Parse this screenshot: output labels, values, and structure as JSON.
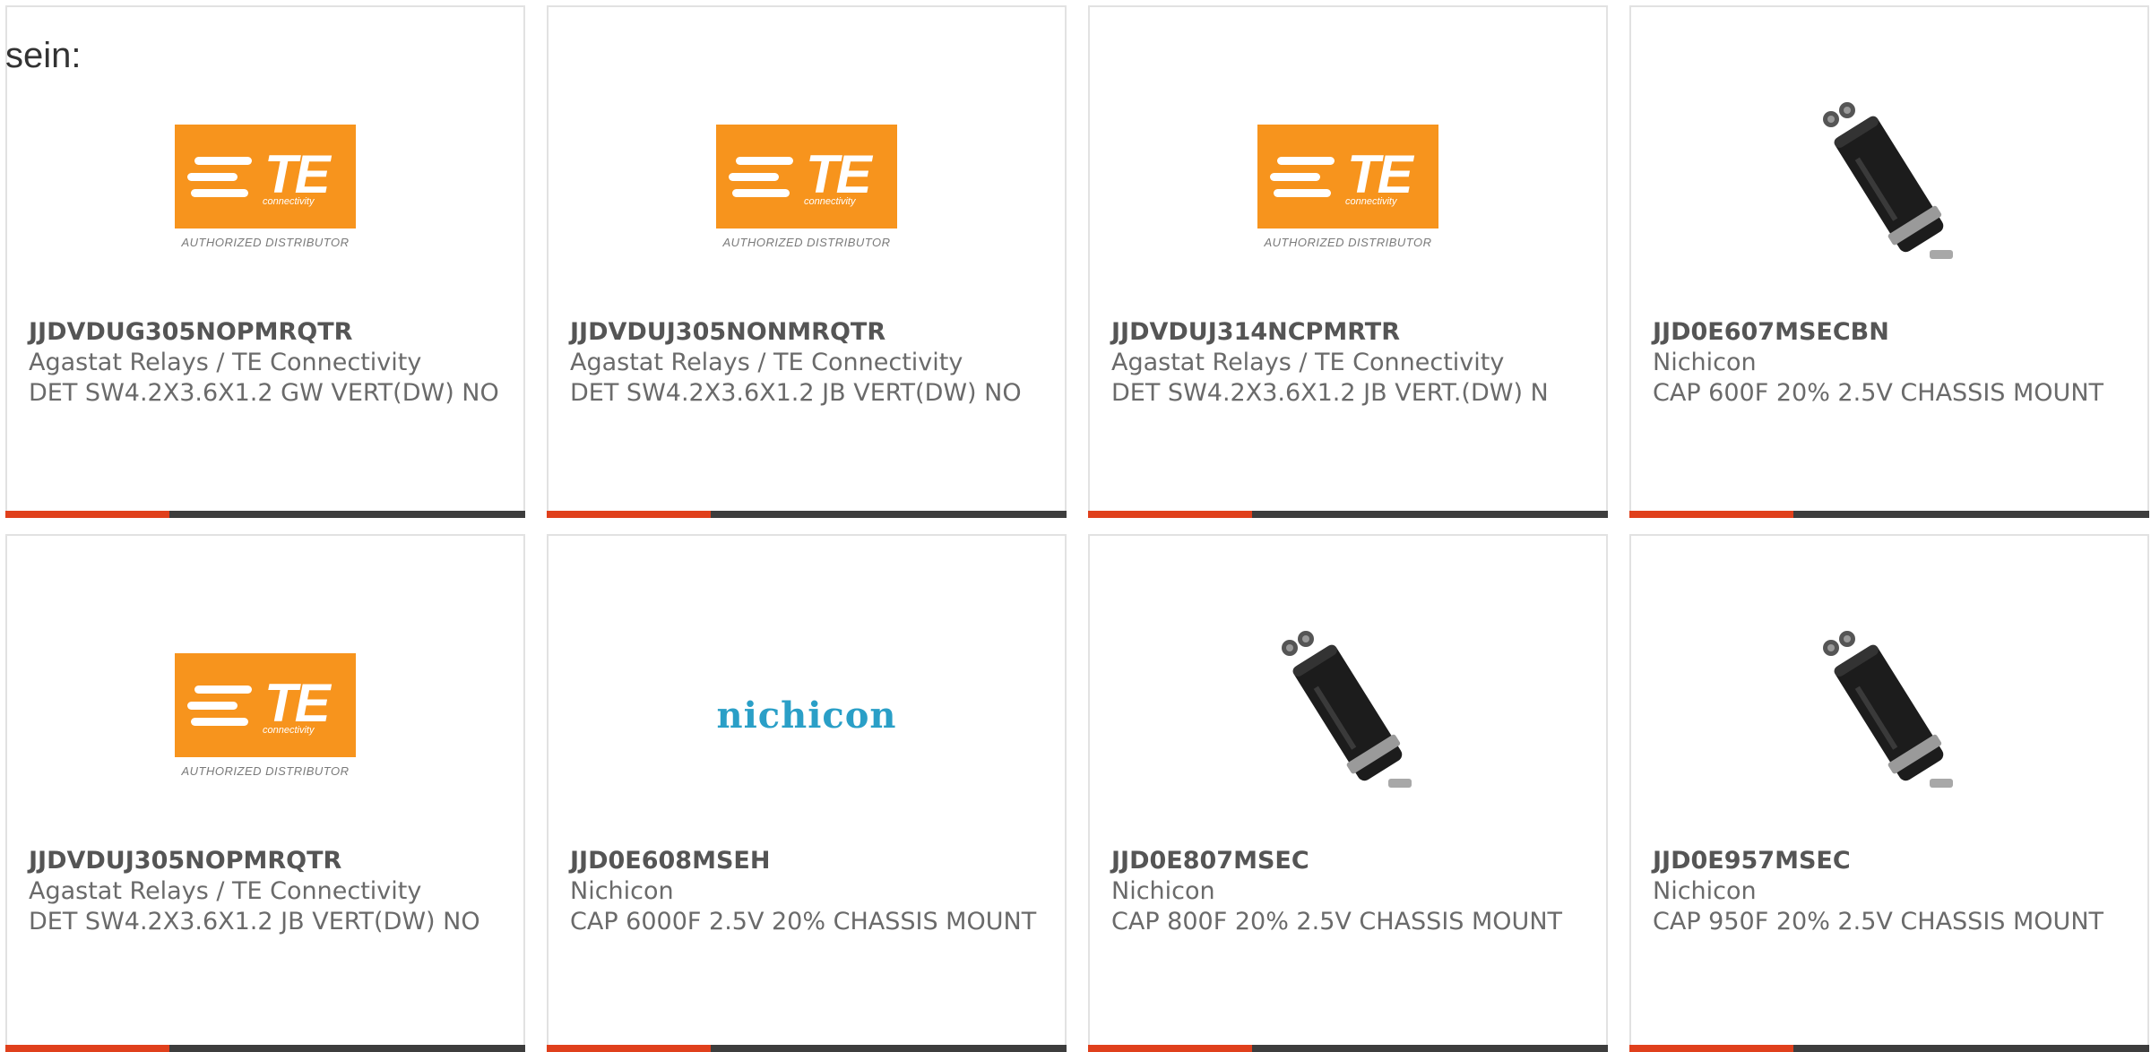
{
  "intro_text": "sein:",
  "colors": {
    "accent_bar": "#e0401c",
    "bar": "#3d3d3d",
    "te_orange": "#f7941d",
    "nichicon_blue": "#2a9fc7"
  },
  "logos": {
    "te": {
      "mark": "TE",
      "sub": "connectivity",
      "dist": "AUTHORIZED DISTRIBUTOR"
    },
    "nichicon": {
      "text": "nichicon"
    }
  },
  "products": [
    {
      "pn": "JJDVDUG305NOPMRQTR",
      "mfr": "Agastat Relays / TE Connectivity",
      "desc": "DET SW4.2X3.6X1.2 GW VERT(DW) NO",
      "image": "te-logo"
    },
    {
      "pn": "JJDVDUJ305NONMRQTR",
      "mfr": "Agastat Relays / TE Connectivity",
      "desc": "DET SW4.2X3.6X1.2 JB VERT(DW) NO",
      "image": "te-logo"
    },
    {
      "pn": "JJDVDUJ314NCPMRTR",
      "mfr": "Agastat Relays / TE Connectivity",
      "desc": "DET SW4.2X3.6X1.2 JB VERT.(DW) N",
      "image": "te-logo"
    },
    {
      "pn": "JJD0E607MSECBN",
      "mfr": "Nichicon",
      "desc": "CAP 600F 20% 2.5V CHASSIS MOUNT",
      "image": "capacitor-photo"
    },
    {
      "pn": "JJDVDUJ305NOPMRQTR",
      "mfr": "Agastat Relays / TE Connectivity",
      "desc": "DET SW4.2X3.6X1.2 JB VERT(DW) NO",
      "image": "te-logo"
    },
    {
      "pn": "JJD0E608MSEH",
      "mfr": "Nichicon",
      "desc": "CAP 6000F 2.5V 20% CHASSIS MOUNT",
      "image": "nichicon-logo"
    },
    {
      "pn": "JJD0E807MSEC",
      "mfr": "Nichicon",
      "desc": "CAP 800F 20% 2.5V CHASSIS MOUNT",
      "image": "capacitor-photo"
    },
    {
      "pn": "JJD0E957MSEC",
      "mfr": "Nichicon",
      "desc": "CAP 950F 20% 2.5V CHASSIS MOUNT",
      "image": "capacitor-photo"
    }
  ]
}
